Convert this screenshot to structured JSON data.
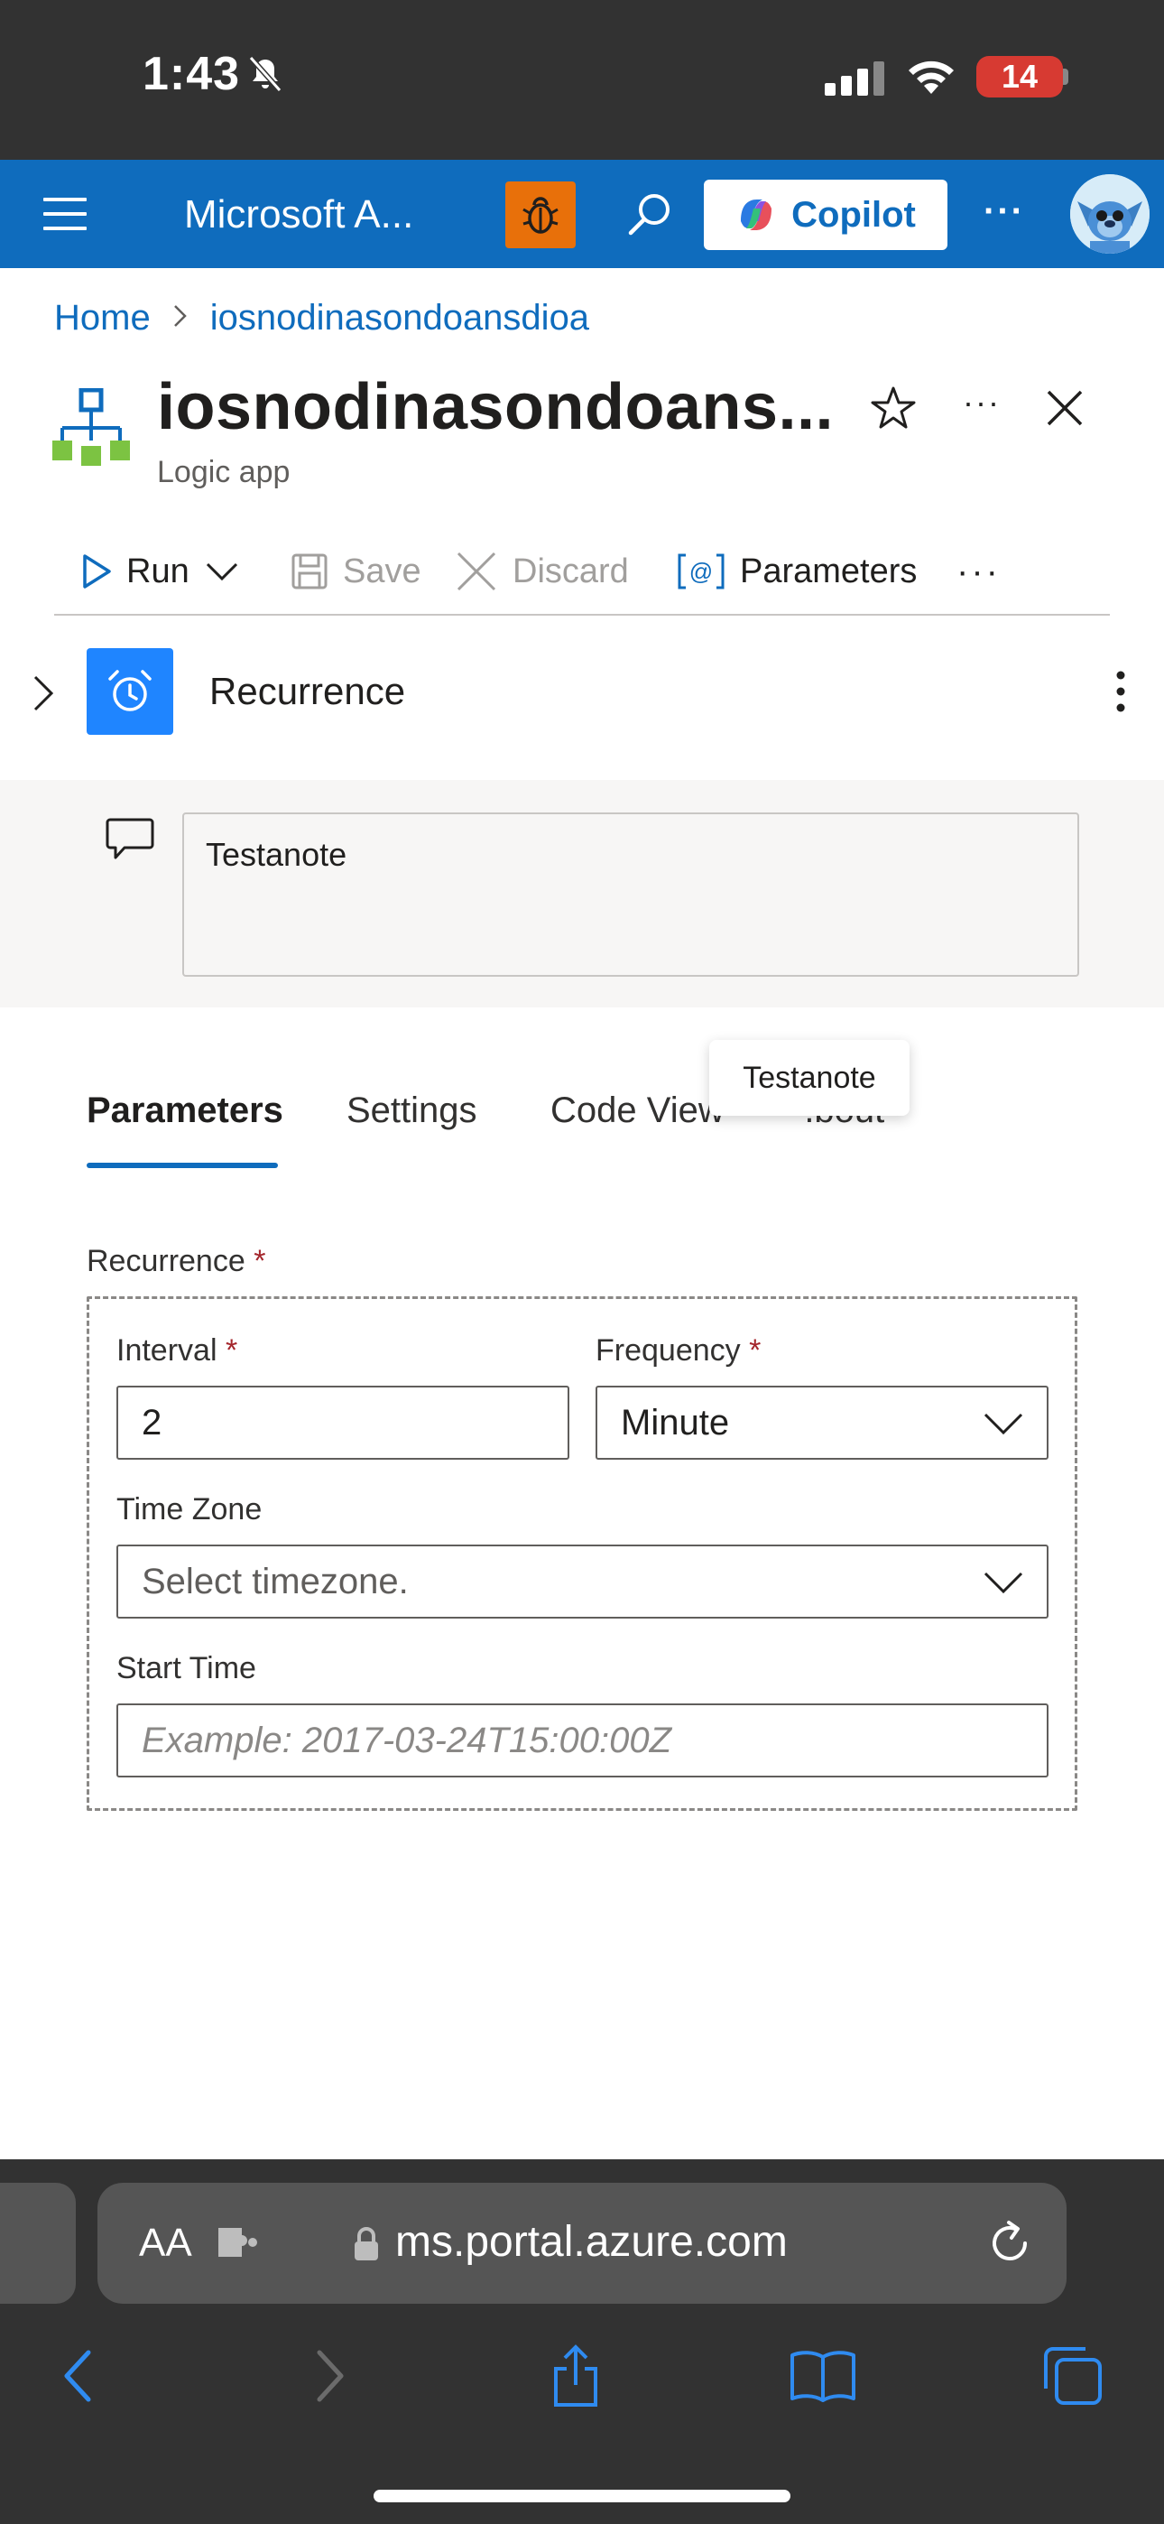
{
  "status_bar": {
    "time": "1:43",
    "battery": "14",
    "icons": [
      "bell-slash-icon",
      "cellular-signal-icon",
      "wifi-icon",
      "battery-icon"
    ]
  },
  "topbar": {
    "title": "Microsoft A...",
    "copilot_label": "Copilot",
    "more_label": "···",
    "brand_color": "#0f6cbd",
    "bug_color": "#e8700a"
  },
  "breadcrumb": {
    "items": [
      "Home",
      "iosnodinasondoansdioa"
    ]
  },
  "resource": {
    "title": "iosnodinasondoans...",
    "type": "Logic app",
    "more_label": "···"
  },
  "commands": {
    "run": "Run",
    "save": "Save",
    "discard": "Discard",
    "parameters": "Parameters",
    "more": "···"
  },
  "card": {
    "title": "Recurrence",
    "note": "Testanote",
    "icon_color": "#1f85ff"
  },
  "tabs": {
    "items": [
      "Parameters",
      "Settings",
      "Code View",
      "About"
    ],
    "about_visible": "·.bout",
    "active": "Parameters",
    "tooltip": "Testanote"
  },
  "form": {
    "group_label": "Recurrence",
    "required_mark": "*",
    "interval_label": "Interval",
    "interval_value": "2",
    "frequency_label": "Frequency",
    "frequency_value": "Minute",
    "timezone_label": "Time Zone",
    "timezone_placeholder": "Select timezone.",
    "start_time_label": "Start Time",
    "start_time_placeholder": "Example: 2017-03-24T15:00:00Z"
  },
  "safari": {
    "aa_label": "AA",
    "url": "ms.portal.azure.com"
  }
}
